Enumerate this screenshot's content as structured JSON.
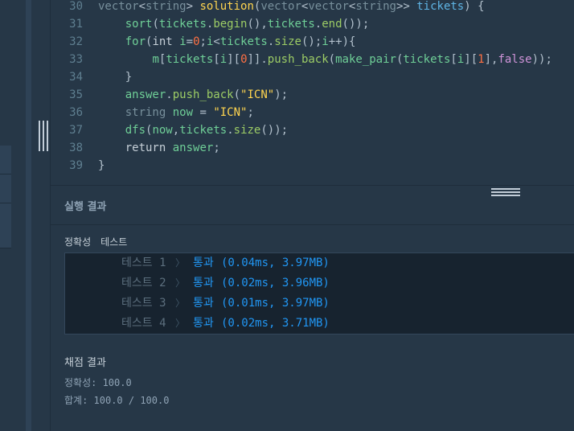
{
  "editor": {
    "lines": [
      {
        "num": "30",
        "tokens": [
          {
            "t": "vector",
            "c": "k-type"
          },
          {
            "t": "<",
            "c": "k-op"
          },
          {
            "t": "string",
            "c": "k-type"
          },
          {
            "t": "> ",
            "c": "k-op"
          },
          {
            "t": "solution",
            "c": "k-fn"
          },
          {
            "t": "(",
            "c": "k-op"
          },
          {
            "t": "vector",
            "c": "k-type"
          },
          {
            "t": "<",
            "c": "k-op"
          },
          {
            "t": "vector",
            "c": "k-type"
          },
          {
            "t": "<",
            "c": "k-op"
          },
          {
            "t": "string",
            "c": "k-type"
          },
          {
            "t": ">> ",
            "c": "k-op"
          },
          {
            "t": "tickets",
            "c": "k-var"
          },
          {
            "t": ") {",
            "c": "k-op"
          }
        ]
      },
      {
        "num": "31",
        "tokens": [
          {
            "t": "    ",
            "c": "k-op"
          },
          {
            "t": "sort",
            "c": "k-ident"
          },
          {
            "t": "(",
            "c": "k-op"
          },
          {
            "t": "tickets",
            "c": "k-ident"
          },
          {
            "t": ".",
            "c": "k-op"
          },
          {
            "t": "begin",
            "c": "k-mem"
          },
          {
            "t": "(),",
            "c": "k-op"
          },
          {
            "t": "tickets",
            "c": "k-ident"
          },
          {
            "t": ".",
            "c": "k-op"
          },
          {
            "t": "end",
            "c": "k-mem"
          },
          {
            "t": "());",
            "c": "k-op"
          }
        ]
      },
      {
        "num": "32",
        "tokens": [
          {
            "t": "    ",
            "c": "k-op"
          },
          {
            "t": "for",
            "c": "k-ident"
          },
          {
            "t": "(",
            "c": "k-op"
          },
          {
            "t": "int",
            "c": "k-kw"
          },
          {
            "t": " ",
            "c": "k-op"
          },
          {
            "t": "i",
            "c": "k-ident"
          },
          {
            "t": "=",
            "c": "k-op"
          },
          {
            "t": "0",
            "c": "k-num"
          },
          {
            "t": ";",
            "c": "k-op"
          },
          {
            "t": "i",
            "c": "k-ident"
          },
          {
            "t": "<",
            "c": "k-op"
          },
          {
            "t": "tickets",
            "c": "k-ident"
          },
          {
            "t": ".",
            "c": "k-op"
          },
          {
            "t": "size",
            "c": "k-mem"
          },
          {
            "t": "();",
            "c": "k-op"
          },
          {
            "t": "i",
            "c": "k-ident"
          },
          {
            "t": "++){",
            "c": "k-op"
          }
        ]
      },
      {
        "num": "33",
        "tokens": [
          {
            "t": "        ",
            "c": "k-op"
          },
          {
            "t": "m",
            "c": "k-ident"
          },
          {
            "t": "[",
            "c": "k-op"
          },
          {
            "t": "tickets",
            "c": "k-ident"
          },
          {
            "t": "[",
            "c": "k-op"
          },
          {
            "t": "i",
            "c": "k-ident"
          },
          {
            "t": "][",
            "c": "k-op"
          },
          {
            "t": "0",
            "c": "k-num"
          },
          {
            "t": "]].",
            "c": "k-op"
          },
          {
            "t": "push_back",
            "c": "k-mem"
          },
          {
            "t": "(",
            "c": "k-op"
          },
          {
            "t": "make_pair",
            "c": "k-ident"
          },
          {
            "t": "(",
            "c": "k-op"
          },
          {
            "t": "tickets",
            "c": "k-ident"
          },
          {
            "t": "[",
            "c": "k-op"
          },
          {
            "t": "i",
            "c": "k-ident"
          },
          {
            "t": "][",
            "c": "k-op"
          },
          {
            "t": "1",
            "c": "k-num"
          },
          {
            "t": "],",
            "c": "k-op"
          },
          {
            "t": "false",
            "c": "k-bool"
          },
          {
            "t": "));",
            "c": "k-op"
          }
        ]
      },
      {
        "num": "34",
        "tokens": [
          {
            "t": "    }",
            "c": "k-op"
          }
        ]
      },
      {
        "num": "35",
        "tokens": [
          {
            "t": "    ",
            "c": "k-op"
          },
          {
            "t": "answer",
            "c": "k-ident"
          },
          {
            "t": ".",
            "c": "k-op"
          },
          {
            "t": "push_back",
            "c": "k-mem"
          },
          {
            "t": "(",
            "c": "k-op"
          },
          {
            "t": "\"ICN\"",
            "c": "k-str"
          },
          {
            "t": ");",
            "c": "k-op"
          }
        ]
      },
      {
        "num": "36",
        "tokens": [
          {
            "t": "    ",
            "c": "k-op"
          },
          {
            "t": "string",
            "c": "k-type"
          },
          {
            "t": " ",
            "c": "k-op"
          },
          {
            "t": "now",
            "c": "k-ident"
          },
          {
            "t": " = ",
            "c": "k-op"
          },
          {
            "t": "\"ICN\"",
            "c": "k-str"
          },
          {
            "t": ";",
            "c": "k-op"
          }
        ]
      },
      {
        "num": "37",
        "tokens": [
          {
            "t": "    ",
            "c": "k-op"
          },
          {
            "t": "dfs",
            "c": "k-ident"
          },
          {
            "t": "(",
            "c": "k-op"
          },
          {
            "t": "now",
            "c": "k-ident"
          },
          {
            "t": ",",
            "c": "k-op"
          },
          {
            "t": "tickets",
            "c": "k-ident"
          },
          {
            "t": ".",
            "c": "k-op"
          },
          {
            "t": "size",
            "c": "k-mem"
          },
          {
            "t": "());",
            "c": "k-op"
          }
        ]
      },
      {
        "num": "38",
        "tokens": [
          {
            "t": "    ",
            "c": "k-op"
          },
          {
            "t": "return",
            "c": "k-kw"
          },
          {
            "t": " ",
            "c": "k-op"
          },
          {
            "t": "answer",
            "c": "k-ident"
          },
          {
            "t": ";",
            "c": "k-op"
          }
        ]
      },
      {
        "num": "39",
        "tokens": [
          {
            "t": "}",
            "c": "k-op"
          }
        ]
      }
    ]
  },
  "results": {
    "title": "실행 결과",
    "tabs": [
      "정확성",
      "테스트"
    ],
    "rows": [
      {
        "label": "테스트 1",
        "chevron": "〉",
        "status": "통과",
        "detail": "(0.04ms, 3.97MB)"
      },
      {
        "label": "테스트 2",
        "chevron": "〉",
        "status": "통과",
        "detail": "(0.02ms, 3.96MB)"
      },
      {
        "label": "테스트 3",
        "chevron": "〉",
        "status": "통과",
        "detail": "(0.01ms, 3.97MB)"
      },
      {
        "label": "테스트 4",
        "chevron": "〉",
        "status": "통과",
        "detail": "(0.02ms, 3.71MB)"
      }
    ]
  },
  "grading": {
    "title": "채점 결과",
    "accuracy": "정확성: 100.0",
    "total": "합계: 100.0 / 100.0"
  }
}
